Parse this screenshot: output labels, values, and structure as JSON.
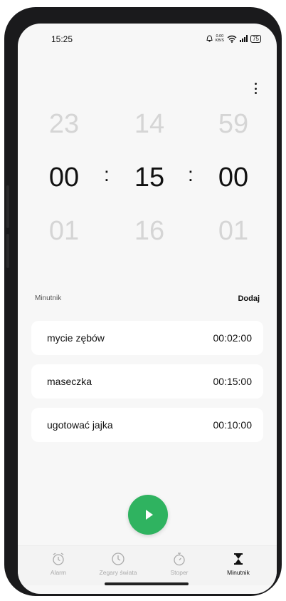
{
  "status_bar": {
    "time": "15:25",
    "net_speed": "0.00",
    "net_unit": "KB/S",
    "battery": "75"
  },
  "picker": {
    "rows": [
      [
        "23",
        "14",
        "59"
      ],
      [
        "00",
        "15",
        "00"
      ],
      [
        "01",
        "16",
        "01"
      ]
    ],
    "separator": ":"
  },
  "presets": {
    "label": "Minutnik",
    "add_label": "Dodaj",
    "items": [
      {
        "name": "mycie zębów",
        "duration": "00:02:00"
      },
      {
        "name": "maseczka",
        "duration": "00:15:00"
      },
      {
        "name": "ugotować jajka",
        "duration": "00:10:00"
      }
    ]
  },
  "tabs": [
    {
      "label": "Alarm",
      "icon": "alarm-clock-icon",
      "active": false
    },
    {
      "label": "Zegary świata",
      "icon": "clock-icon",
      "active": false
    },
    {
      "label": "Stoper",
      "icon": "stopwatch-icon",
      "active": false
    },
    {
      "label": "Minutnik",
      "icon": "hourglass-icon",
      "active": true
    }
  ],
  "colors": {
    "accent": "#2fb360",
    "background": "#f7f7f7",
    "inactive_tab": "#aaaaaa"
  }
}
